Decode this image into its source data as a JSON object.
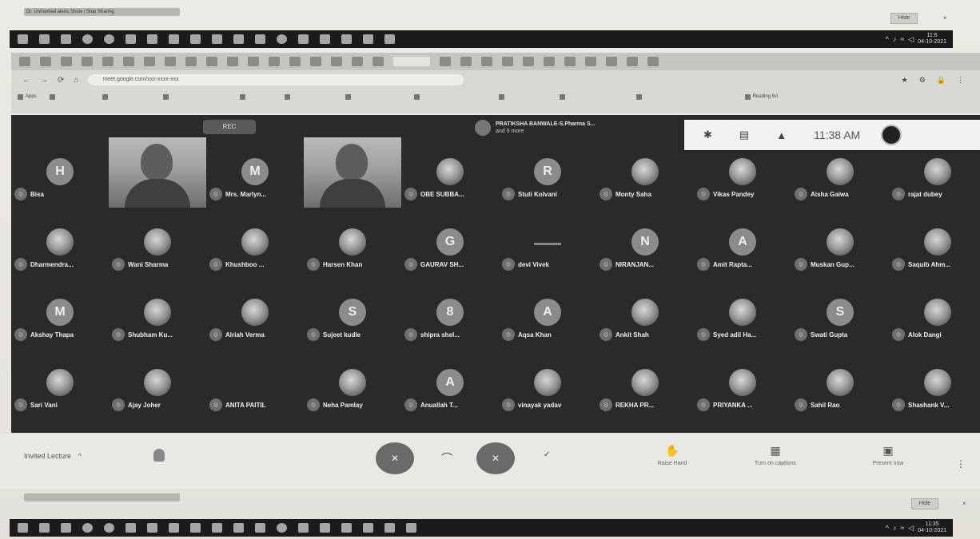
{
  "screen": {
    "notice_top": {
      "text": "Dr. Unmarked alerts Show / Stop Sharing",
      "close": "×",
      "button": "Hide"
    },
    "notice_bottom": {
      "text": "",
      "close": "×",
      "button": "Hide"
    },
    "taskbar_top": {
      "time": "11:6",
      "date": "04-10-2021"
    },
    "taskbar_bottom": {
      "time": "11:35",
      "date": "04-10-2021"
    }
  },
  "browser": {
    "url": "meet.google.com/xxx-xxxx-xxx",
    "nav_icons": [
      "←",
      "→",
      "⟳",
      "⌂"
    ],
    "right_icons": [
      "★",
      "⚙",
      "🔒",
      "⋮"
    ],
    "bookmarks": [
      "Apps",
      "",
      "",
      "",
      "",
      "",
      "",
      "",
      "",
      "",
      "",
      "Reading list"
    ]
  },
  "meet": {
    "rec_label": "REC",
    "presenter": {
      "name": "PRATIKSHA BANWALE-S.Pharma S...",
      "sub": "and 5 more"
    },
    "top_panel": {
      "people_icon": "people-icon",
      "chat_icon": "chat-icon",
      "activities_icon": "activities-icon",
      "time": "11:38 AM"
    },
    "participants": [
      {
        "name": "Bisa",
        "initial": "H",
        "type": "letter"
      },
      {
        "name": "",
        "type": "video"
      },
      {
        "name": "Mrs. Marlyn...",
        "initial": "M",
        "type": "letter"
      },
      {
        "name": "",
        "type": "video"
      },
      {
        "name": "OBE SUBBA...",
        "initial": "",
        "type": "photo"
      },
      {
        "name": "Stuti Kolvani",
        "initial": "R",
        "type": "letter"
      },
      {
        "name": "Monty Saha",
        "initial": "",
        "type": "photo"
      },
      {
        "name": "Vikas Pandey",
        "initial": "",
        "type": "photo"
      },
      {
        "name": "Aisha Gaiwa",
        "initial": "",
        "type": "photo"
      },
      {
        "name": "rajat dubey",
        "initial": "",
        "type": "photo"
      },
      {
        "name": "Dharmendra...",
        "initial": "",
        "type": "photo"
      },
      {
        "name": "Wani Sharma",
        "initial": "",
        "type": "photo"
      },
      {
        "name": "Khushboo ...",
        "initial": "",
        "type": "photo"
      },
      {
        "name": "Harsen Khan",
        "initial": "",
        "type": "photo"
      },
      {
        "name": "GAURAV SH...",
        "initial": "G",
        "type": "letter"
      },
      {
        "name": "devi Vivek",
        "initial": "",
        "type": "dash"
      },
      {
        "name": "NIRANJAN...",
        "initial": "N",
        "type": "letter"
      },
      {
        "name": "Amit Rapta...",
        "initial": "A",
        "type": "letter"
      },
      {
        "name": "Muskan Gup...",
        "initial": "",
        "type": "photo"
      },
      {
        "name": "Saquib Ahm...",
        "initial": "",
        "type": "photo"
      },
      {
        "name": "Akshay Thapa",
        "initial": "M",
        "type": "letter"
      },
      {
        "name": "Shubham Ku...",
        "initial": "",
        "type": "photo"
      },
      {
        "name": "Alriah Verma",
        "initial": "",
        "type": "photo"
      },
      {
        "name": "Sujeet kudle",
        "initial": "S",
        "type": "letter"
      },
      {
        "name": "shipra shel...",
        "initial": "8",
        "type": "letter"
      },
      {
        "name": "Aqsa Khan",
        "initial": "A",
        "type": "letter"
      },
      {
        "name": "Ankit Shah",
        "initial": "",
        "type": "photo"
      },
      {
        "name": "Syed adil Ha...",
        "initial": "",
        "type": "photo"
      },
      {
        "name": "Swati Gupta",
        "initial": "S",
        "type": "letter"
      },
      {
        "name": "Alok Dangi",
        "initial": "",
        "type": "photo"
      },
      {
        "name": "Sari Vani",
        "initial": "",
        "type": "photo"
      },
      {
        "name": "Ajay Joher",
        "initial": "",
        "type": "photo"
      },
      {
        "name": "ANITA PAITIL",
        "initial": "",
        "type": "blank"
      },
      {
        "name": "Neha Pamlay",
        "initial": "",
        "type": "photo"
      },
      {
        "name": "Anuallah T...",
        "initial": "A",
        "type": "letter"
      },
      {
        "name": "vinayak yadav",
        "initial": "",
        "type": "photo"
      },
      {
        "name": "REKHA PR...",
        "initial": "",
        "type": "photo"
      },
      {
        "name": "PRIYANKA ...",
        "initial": "",
        "type": "photo"
      },
      {
        "name": "Sahil Rao",
        "initial": "",
        "type": "photo"
      },
      {
        "name": "Shashank V...",
        "initial": "",
        "type": "photo"
      }
    ]
  },
  "meeting_bar": {
    "title": "Invited Lecture",
    "title_chevron": "^",
    "mic_label": "✕",
    "cam_label": "✕",
    "end_glyph": "⌒",
    "more_glyph": "⋮",
    "actions": [
      {
        "label": "Raise Hand",
        "icon": "hand-icon"
      },
      {
        "label": "Turn on captions",
        "icon": "captions-icon"
      },
      {
        "label": "Present now",
        "icon": "present-icon"
      }
    ]
  }
}
